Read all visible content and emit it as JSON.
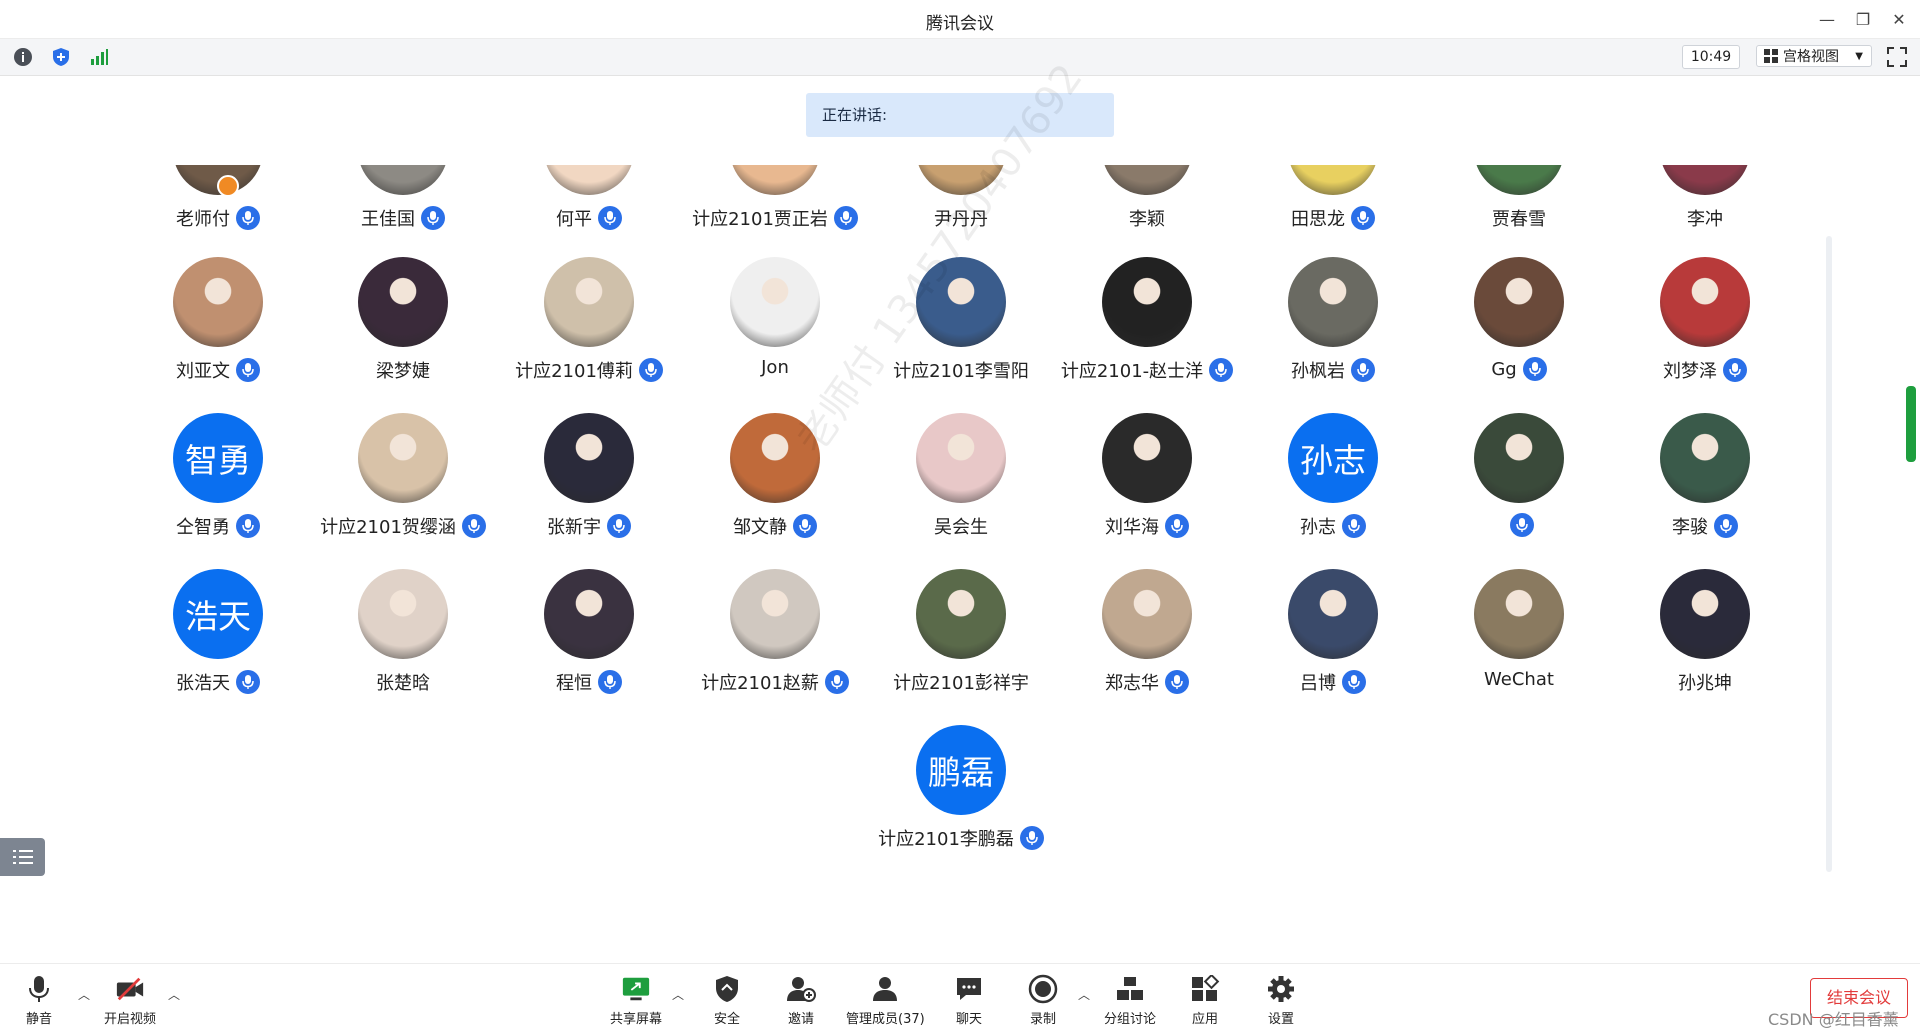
{
  "window": {
    "title": "腾讯会议"
  },
  "toolbar": {
    "time": "10:49",
    "view_label": "宫格视图"
  },
  "speaking": {
    "label": "正在讲话:"
  },
  "participants": [
    {
      "name": "老师付",
      "host": true,
      "mic": true,
      "avatar_color": "#6f5a48"
    },
    {
      "name": "王佳国",
      "mic": true,
      "avatar_color": "#8d8a84"
    },
    {
      "name": "何平",
      "mic": true,
      "avatar_color": "#f1d7c2"
    },
    {
      "name": "计应2101贾正岩",
      "mic": true,
      "avatar_color": "#e8b890"
    },
    {
      "name": "尹丹丹",
      "mic": false,
      "avatar_color": "#c8a070"
    },
    {
      "name": "李颖",
      "mic": false,
      "avatar_color": "#8a7a6a"
    },
    {
      "name": "田思龙",
      "mic": true,
      "avatar_color": "#e8d060"
    },
    {
      "name": "贾春雪",
      "mic": false,
      "avatar_color": "#4a7a4a"
    },
    {
      "name": "李冲",
      "mic": false,
      "avatar_color": "#8a3a4a"
    },
    {
      "name": "刘亚文",
      "mic": true,
      "avatar_color": "#c09070"
    },
    {
      "name": "梁梦婕",
      "mic": false,
      "avatar_color": "#3a2a3a"
    },
    {
      "name": "计应2101傅莉",
      "mic": true,
      "avatar_color": "#cfc0aa"
    },
    {
      "name": "Jon",
      "mic": false,
      "avatar_color": "#efefef"
    },
    {
      "name": "计应2101李雪阳",
      "mic": false,
      "avatar_color": "#3a5c8c"
    },
    {
      "name": "计应2101-赵士洋",
      "mic": true,
      "avatar_color": "#222222"
    },
    {
      "name": "孙枫岩",
      "mic": true,
      "avatar_color": "#6a6a62"
    },
    {
      "name": "Gg",
      "mic": true,
      "avatar_color": "#6a4a3a"
    },
    {
      "name": "刘梦泽",
      "mic": true,
      "avatar_color": "#b83a3a"
    },
    {
      "name": "仝智勇",
      "mic": true,
      "text_avatar": "智勇"
    },
    {
      "name": "计应2101贺缨涵",
      "mic": true,
      "avatar_color": "#d8c2a8"
    },
    {
      "name": "张新宇",
      "mic": true,
      "avatar_color": "#2a2a3a"
    },
    {
      "name": "邹文静",
      "mic": true,
      "avatar_color": "#c06a3a"
    },
    {
      "name": "吴会生",
      "mic": false,
      "avatar_color": "#e8c8c8"
    },
    {
      "name": "刘华海",
      "mic": true,
      "avatar_color": "#2a2a2a"
    },
    {
      "name": "孙志",
      "mic": true,
      "text_avatar": "孙志"
    },
    {
      "name": "",
      "mic": true,
      "avatar_color": "#3a4a3a"
    },
    {
      "name": "李骏",
      "mic": true,
      "avatar_color": "#3a5a4a"
    },
    {
      "name": "张浩天",
      "mic": true,
      "text_avatar": "浩天"
    },
    {
      "name": "张楚晗",
      "mic": false,
      "avatar_color": "#e0d2c8"
    },
    {
      "name": "程恒",
      "mic": true,
      "avatar_color": "#3a3240"
    },
    {
      "name": "计应2101赵薪",
      "mic": true,
      "avatar_color": "#d0c8c0"
    },
    {
      "name": "计应2101彭祥宇",
      "mic": false,
      "avatar_color": "#5a6a4a"
    },
    {
      "name": "郑志华",
      "mic": true,
      "avatar_color": "#c0a890"
    },
    {
      "name": "吕博",
      "mic": true,
      "avatar_color": "#3a4a6a"
    },
    {
      "name": "WeChat",
      "mic": false,
      "avatar_color": "#8a7a60"
    },
    {
      "name": "孙兆坤",
      "mic": false,
      "avatar_color": "#2a2a3a"
    },
    {
      "name": "计应2101李鹏磊",
      "mic": true,
      "text_avatar": "鹏磊"
    }
  ],
  "bottombar": {
    "mute": "静音",
    "video": "开启视频",
    "share": "共享屏幕",
    "security": "安全",
    "invite": "邀请",
    "members": "管理成员(37)",
    "chat": "聊天",
    "record": "录制",
    "breakout": "分组讨论",
    "apps": "应用",
    "settings": "设置",
    "end": "结束会议"
  },
  "watermark": "老师付 1345720407692",
  "csdn": "CSDN @红目香薰",
  "colors": {
    "accent": "#0a6ff0",
    "end_red": "#e23b3b",
    "signal_green": "#1e9e3e"
  }
}
